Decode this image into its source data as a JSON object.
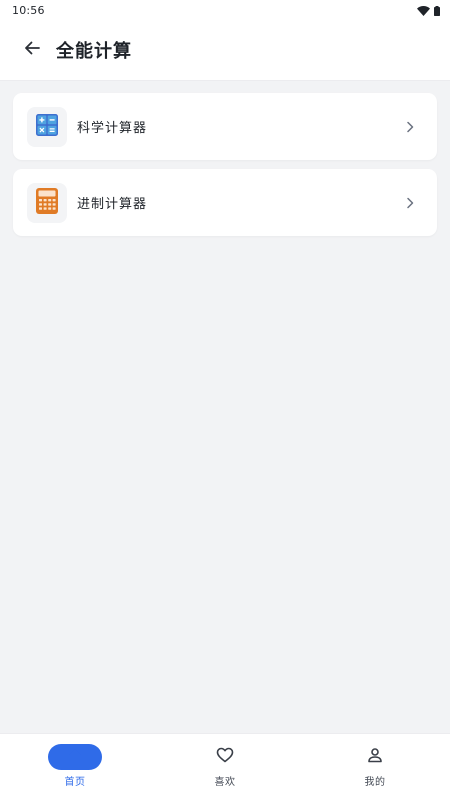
{
  "status_bar": {
    "time": "10:56",
    "icons": [
      "wifi-icon",
      "battery-icon"
    ]
  },
  "header": {
    "title": "全能计算",
    "back_icon": "arrow-left-icon"
  },
  "list": {
    "items": [
      {
        "label": "科学计算器",
        "icon": "scientific-calculator-icon"
      },
      {
        "label": "进制计算器",
        "icon": "base-calculator-icon"
      }
    ]
  },
  "bottom_nav": {
    "active": "home",
    "items": [
      {
        "label": "首页",
        "icon": "home-icon"
      },
      {
        "label": "喜欢",
        "icon": "heart-icon"
      },
      {
        "label": "我的",
        "icon": "person-icon"
      }
    ]
  },
  "colors": {
    "accent": "#2f6be8",
    "background": "#f2f3f5",
    "card": "#ffffff",
    "scientific_icon": "#3e6fcf",
    "base_icon": "#e07b26"
  }
}
